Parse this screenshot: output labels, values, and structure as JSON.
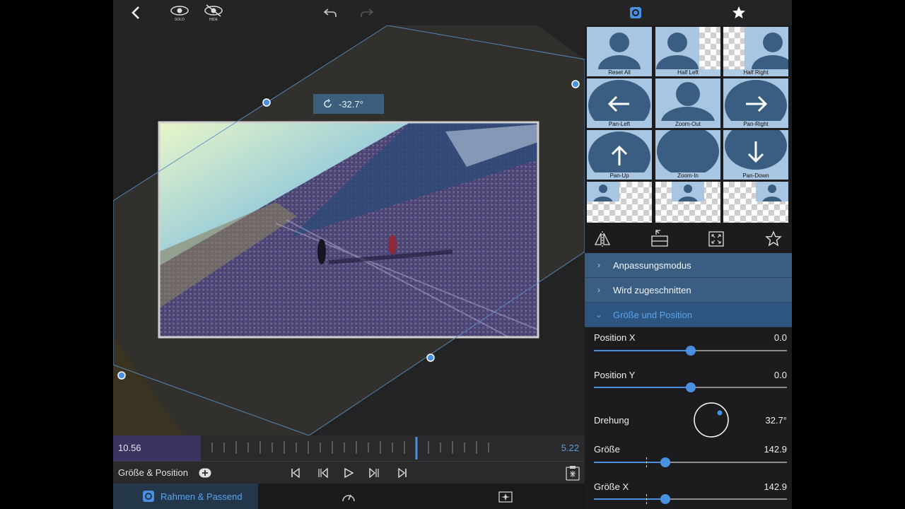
{
  "toolbar": {
    "solo_label": "SOLO",
    "hide_label": "HIDE"
  },
  "viewer": {
    "rotation_readout": "-32.7°"
  },
  "timeline": {
    "current_time": "10.56",
    "remaining_time": "5.22"
  },
  "transport": {
    "label": "Größe & Position"
  },
  "tabs": {
    "active_label": "Rahmen & Passend"
  },
  "presets": [
    {
      "label": "Reset All"
    },
    {
      "label": "Half Left"
    },
    {
      "label": "Half Right"
    },
    {
      "label": "Pan-Left"
    },
    {
      "label": "Zoom-Out"
    },
    {
      "label": "Pan-Right"
    },
    {
      "label": "Pan-Up"
    },
    {
      "label": "Zoom-In"
    },
    {
      "label": "Pan-Down"
    }
  ],
  "sections": [
    {
      "label": "Anpassungsmodus"
    },
    {
      "label": "Wird zugeschnitten"
    },
    {
      "label": "Größe und Position"
    }
  ],
  "properties": {
    "position_x": {
      "label": "Position X",
      "value": "0.0",
      "fraction": 0.5
    },
    "position_y": {
      "label": "Position Y",
      "value": "0.0",
      "fraction": 0.5
    },
    "rotation": {
      "label": "Drehung",
      "value": "32.7°"
    },
    "size": {
      "label": "Größe",
      "value": "142.9",
      "fraction": 0.37
    },
    "size_x": {
      "label": "Größe X",
      "value": "142.9",
      "fraction": 0.37
    }
  },
  "colors": {
    "accent": "#4a90e2",
    "section_bg": "#3a5e82",
    "preset_bg": "#a8c6e2",
    "timeline_selection": "#3a3560"
  }
}
